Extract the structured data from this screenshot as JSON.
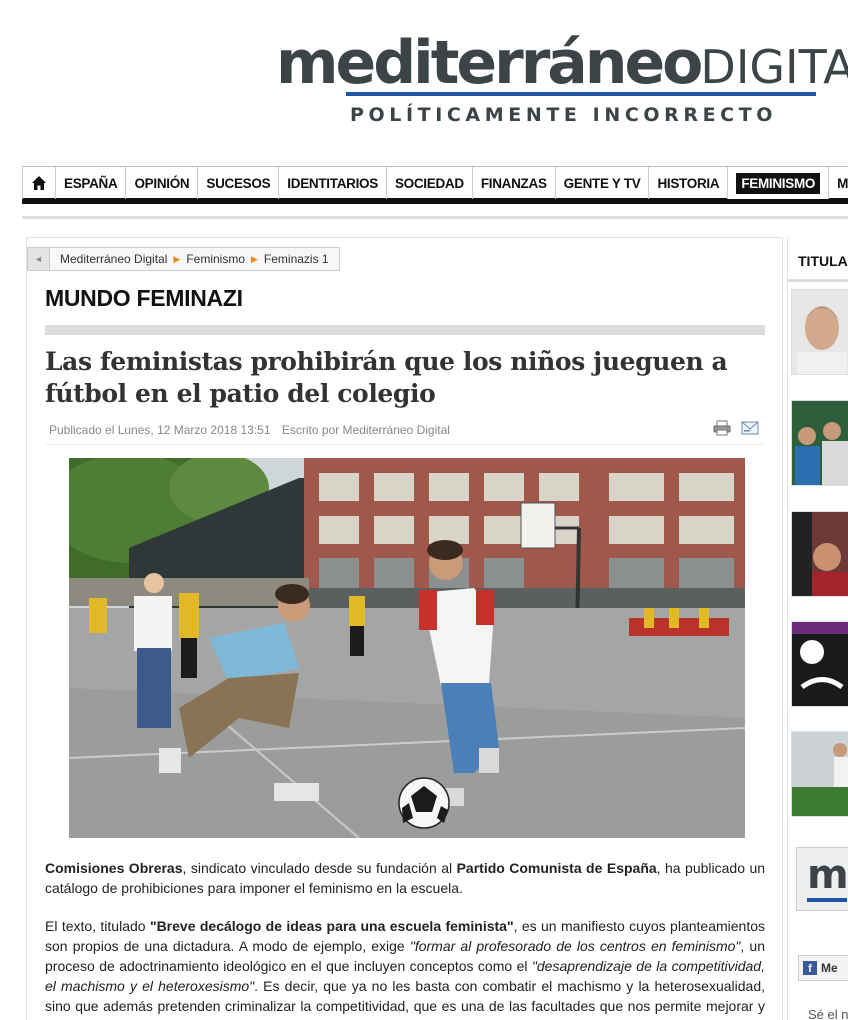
{
  "brand": {
    "name": "mediterráneo",
    "suffix": "DIGITAL",
    "tagline": "POLÍTICAMENTE INCORRECTO",
    "accent_color": "#1f57a4"
  },
  "nav": {
    "home_icon": "home-icon",
    "items": [
      "ESPAÑA",
      "OPINIÓN",
      "SUCESOS",
      "IDENTITARIOS",
      "SOCIEDAD",
      "FINANZAS",
      "GENTE Y TV",
      "HISTORIA",
      "FEMINISMO",
      "MD"
    ],
    "active": "FEMINISMO"
  },
  "breadcrumb": {
    "items": [
      "Mediterráneo Digital",
      "Feminismo",
      "Feminazis 1"
    ]
  },
  "section": {
    "title": "MUNDO FEMINAZI"
  },
  "article": {
    "title": "Las feministas prohibirán que los niños jueguen a fútbol en el patio del colegio",
    "published": "Publicado el Lunes, 12 Marzo 2018 13:51",
    "author": "Escrito por Mediterráneo Digital",
    "p1": {
      "b1": "Comisiones Obreras",
      "t1": ", sindicato vinculado desde su fundación al ",
      "b2": "Partido Comunista de España",
      "t2": ", ha publicado un catálogo de prohibiciones para imponer el feminismo en la escuela."
    },
    "p2": {
      "t1": "El texto, titulado ",
      "b1": "\"Breve decálogo de ideas para una escuela feminista\"",
      "t2": ", es un manifiesto cuyos planteamientos son propios de una dictadura. A modo de ejemplo, exige ",
      "i1": "\"formar al profesorado de los centros en feminismo\"",
      "t3": ", un proceso de adoctrinamiento ideológico en el que incluyen conceptos como el ",
      "i2": "\"desaprendizaje de la competitividad, el machismo y el heteroxesismo\"",
      "t4": ". Es decir, que ya no les basta con combatir el machismo y la heterosexualidad, sino que además pretenden criminalizar la competitividad, que es una de las facultades que nos permite mejorar y aspirar a la excelencia."
    }
  },
  "sidebar": {
    "title": "TITULAR",
    "box_letter": "m",
    "fb_label": "Me",
    "fb_icon": "f",
    "follow_text": "Sé el n"
  }
}
